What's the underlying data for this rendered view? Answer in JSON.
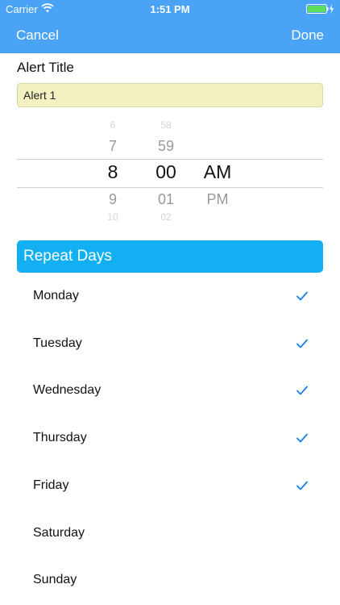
{
  "status": {
    "carrier": "Carrier",
    "time": "1:51 PM"
  },
  "nav": {
    "cancel_label": "Cancel",
    "done_label": "Done"
  },
  "alert": {
    "label": "Alert Title",
    "value": "Alert 1"
  },
  "picker": {
    "hours": [
      "6",
      "7",
      "8",
      "9",
      "10"
    ],
    "minutes": [
      "58",
      "59",
      "00",
      "01",
      "02"
    ],
    "periods": [
      "AM",
      "PM"
    ]
  },
  "repeat": {
    "header": "Repeat Days",
    "days": [
      {
        "label": "Monday",
        "checked": true
      },
      {
        "label": "Tuesday",
        "checked": true
      },
      {
        "label": "Wednesday",
        "checked": true
      },
      {
        "label": "Thursday",
        "checked": true
      },
      {
        "label": "Friday",
        "checked": true
      },
      {
        "label": "Saturday",
        "checked": false
      },
      {
        "label": "Sunday",
        "checked": false
      }
    ]
  },
  "colors": {
    "nav_bar": "#4aa3f5",
    "header": "#12b0f2",
    "checkmark": "#1a7fe0",
    "input_bg": "#f1f1c2"
  },
  "icons": [
    "wifi-icon",
    "battery-icon",
    "check-icon"
  ]
}
